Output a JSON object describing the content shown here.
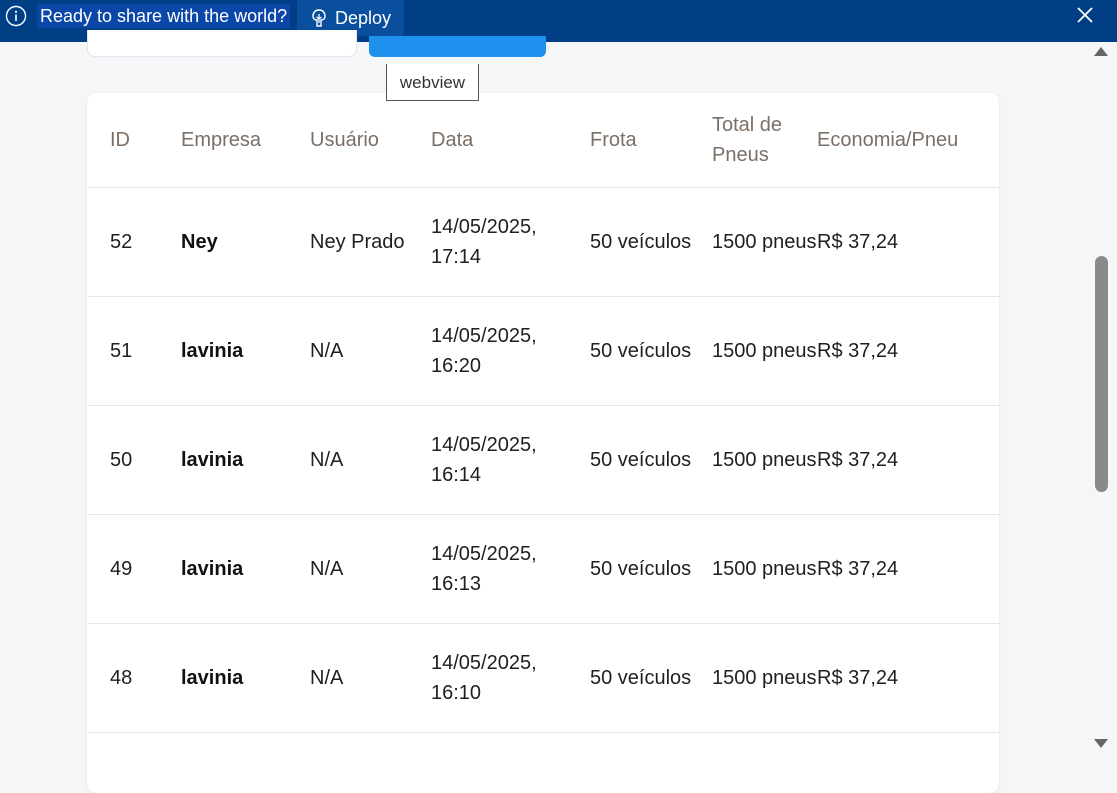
{
  "banner": {
    "message": "Ready to share with the world?",
    "deploy_label": "Deploy"
  },
  "tooltip": "webview",
  "table": {
    "headers": [
      "ID",
      "Empresa",
      "Usuário",
      "Data",
      "Frota",
      "Total de Pneus",
      "Economia/Pneu"
    ],
    "rows": [
      {
        "id": "52",
        "empresa": "Ney",
        "usuario": "Ney Prado",
        "data": "14/05/2025, 17:14",
        "frota": "50 veículos",
        "total_pneus": "1500 pneus",
        "economia": "R$ 37,24"
      },
      {
        "id": "51",
        "empresa": "lavinia",
        "usuario": "N/A",
        "data": "14/05/2025, 16:20",
        "frota": "50 veículos",
        "total_pneus": "1500 pneus",
        "economia": "R$ 37,24"
      },
      {
        "id": "50",
        "empresa": "lavinia",
        "usuario": "N/A",
        "data": "14/05/2025, 16:14",
        "frota": "50 veículos",
        "total_pneus": "1500 pneus",
        "economia": "R$ 37,24"
      },
      {
        "id": "49",
        "empresa": "lavinia",
        "usuario": "N/A",
        "data": "14/05/2025, 16:13",
        "frota": "50 veículos",
        "total_pneus": "1500 pneus",
        "economia": "R$ 37,24"
      },
      {
        "id": "48",
        "empresa": "lavinia",
        "usuario": "N/A",
        "data": "14/05/2025, 16:10",
        "frota": "50 veículos",
        "total_pneus": "1500 pneus",
        "economia": "R$ 37,24"
      }
    ]
  },
  "icons": {
    "info": "info-icon",
    "deploy": "deploy-icon",
    "close": "close-icon"
  },
  "colors": {
    "banner_bg": "#003f86",
    "primary_button": "#1e90ee",
    "header_text": "#7b6f66"
  }
}
